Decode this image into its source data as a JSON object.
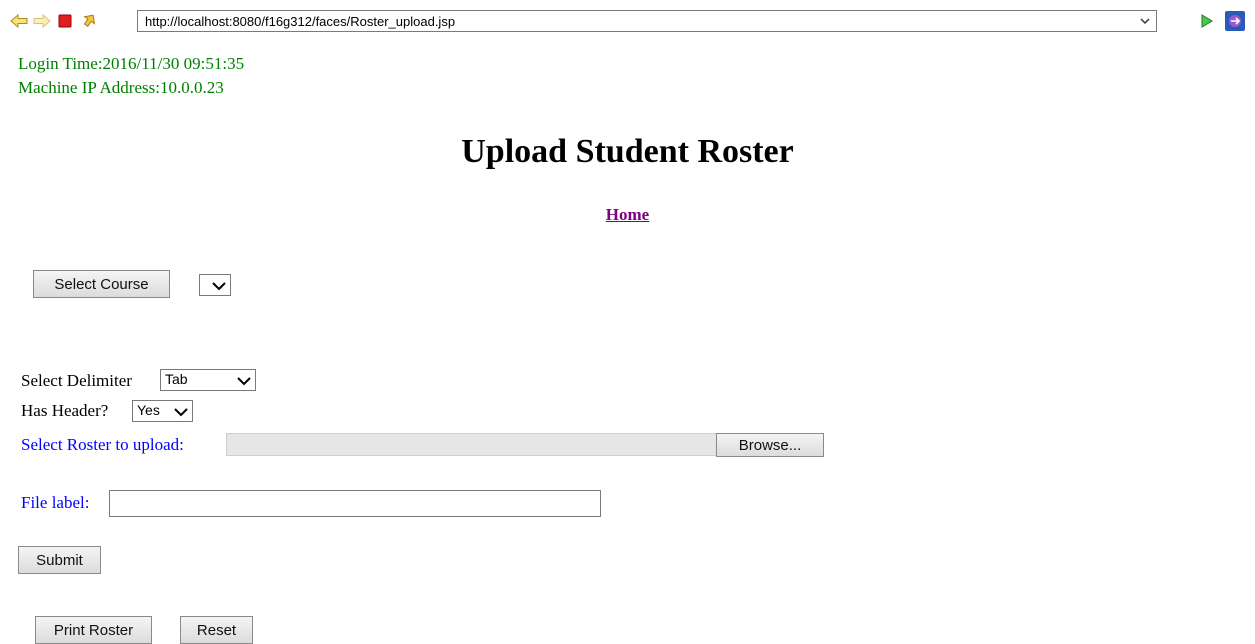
{
  "browser": {
    "url": "http://localhost:8080/f16g312/faces/Roster_upload.jsp",
    "icons": [
      "back-arrow-icon",
      "forward-arrow-icon",
      "stop-icon",
      "refresh-icon",
      "url-dropdown-icon",
      "go-icon",
      "eclipse-icon"
    ]
  },
  "session": {
    "login_time": "Login Time:2016/11/30 09:51:35",
    "machine_ip": "Machine IP Address:10.0.0.23"
  },
  "page": {
    "title": "Upload Student Roster",
    "home_link": "Home"
  },
  "course": {
    "select_button": "Select Course",
    "dropdown_value": ""
  },
  "form": {
    "delimiter_label": "Select Delimiter",
    "delimiter_value": "Tab",
    "header_label": "Has Header?",
    "header_value": "Yes",
    "roster_label": "Select Roster to upload:",
    "browse_button": "Browse...",
    "file_label": "File label:",
    "file_label_value": "",
    "submit_button": "Submit"
  },
  "actions": {
    "print_button": "Print Roster",
    "reset_button": "Reset"
  },
  "colors": {
    "session_text": "#008000",
    "form_label": "#0000ff",
    "home_link": "#800080"
  }
}
